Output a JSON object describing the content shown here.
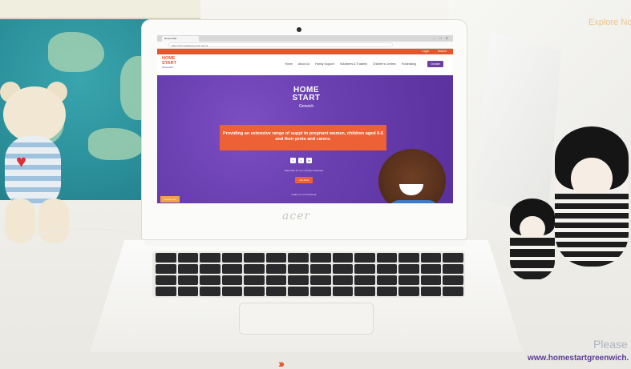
{
  "overlay": {
    "explore_text": "Explore Nov",
    "please_text": "Please",
    "website_text": "www.homestartgreenwich.",
    "next_icon": "double-chevron-right-icon"
  },
  "laptop": {
    "brand": "acer"
  },
  "browser": {
    "tab_title": "Home-Start",
    "url": "https://homestartgreenwich.org.uk",
    "top_strip": {
      "login": "Login",
      "search": "Search"
    },
    "nav": {
      "logo_line1": "HOME",
      "logo_line2": "START",
      "logo_sub": "Greenwich",
      "menu": [
        "Home",
        "About Us",
        "Family Support",
        "Volunteers & Trustees",
        "Children's Centres",
        "Fundraising"
      ],
      "donate_label": "Donate"
    },
    "hero": {
      "logo_line1": "HOME",
      "logo_line2": "START",
      "logo_sub": "Grnwich",
      "headline": "Providing an extensive range of suppt to pregnant women, children aged 0-5 and their prnts and carers.",
      "social": [
        "f",
        "t",
        "in"
      ],
      "subtext": "Subscribe for our monthly newsletter",
      "cta_label": "Join Now",
      "small_text": "Follow us on Facebook",
      "side_tab": "Contact Us"
    }
  },
  "colors": {
    "brand_orange": "#e8542e",
    "brand_purple": "#6b3ea0",
    "hero_purple": "#6a3fb0"
  }
}
